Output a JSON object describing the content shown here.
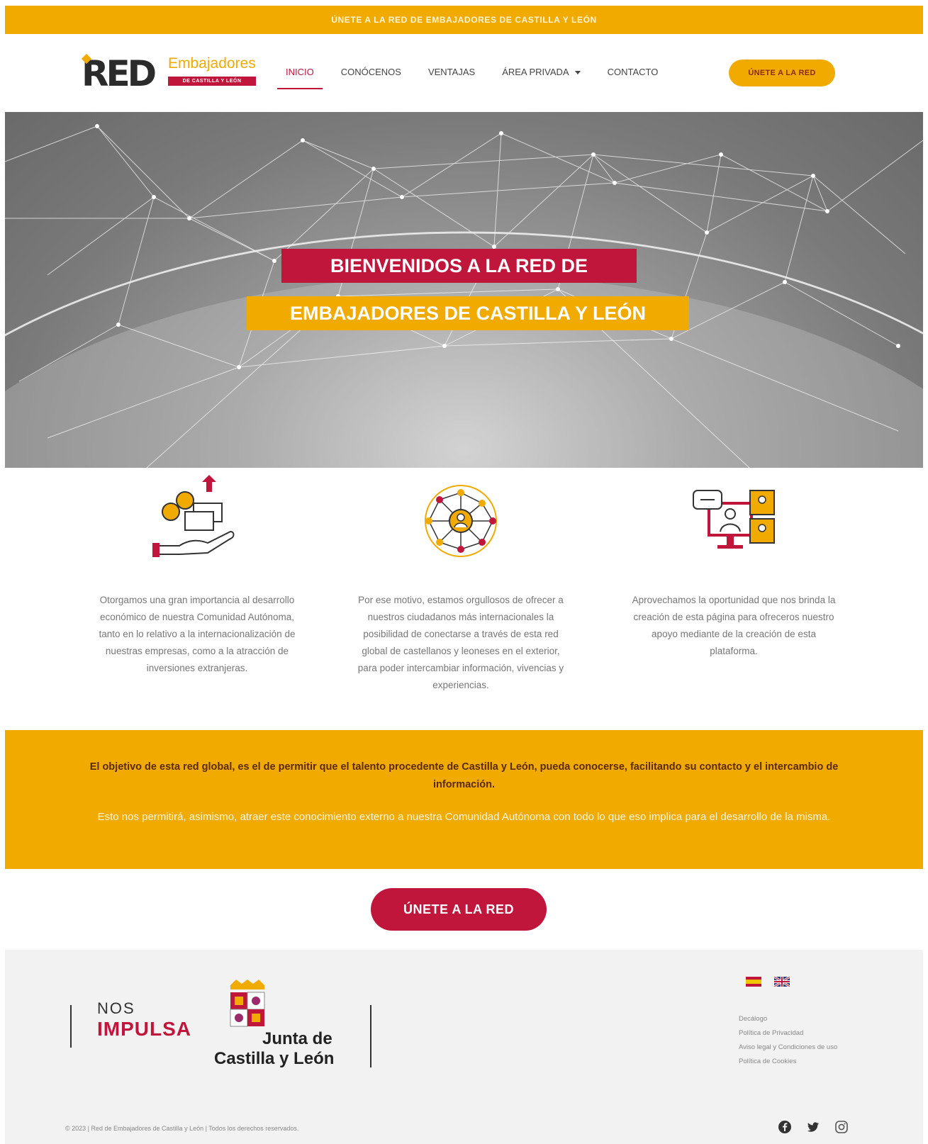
{
  "topbar": {
    "text": "ÚNETE A LA RED DE EMBAJADORES DE CASTILLA Y LEÓN"
  },
  "logo": {
    "main": "RED",
    "emb": "Embajadores",
    "sub": "DE CASTILLA Y LEÓN"
  },
  "nav": {
    "items": [
      {
        "label": "INICIO",
        "active": true
      },
      {
        "label": "CONÓCENOS"
      },
      {
        "label": "VENTAJAS"
      },
      {
        "label": "ÁREA PRIVADA",
        "dropdown": true
      },
      {
        "label": "CONTACTO"
      }
    ],
    "join_label": "ÚNETE A LA RED"
  },
  "hero": {
    "line1": "BIENVENIDOS A LA RED DE",
    "line2": "EMBAJADORES DE CASTILLA Y LEÓN"
  },
  "features": [
    {
      "icon": "money-hand-icon",
      "text": "Otorgamos una gran importancia al desarrollo económico de nuestra Comunidad Autónoma, tanto en lo relativo a la internacionalización de nuestras empresas, como a la atracción de inversiones extranjeras."
    },
    {
      "icon": "globe-network-icon",
      "text": "Por ese motivo, estamos orgullosos de ofrecer a nuestros ciudadanos más internacionales la posibilidad de conectarse a través de esta red global de castellanos y leoneses en el exterior, para poder intercambiar información, vivencias y experiencias."
    },
    {
      "icon": "video-conference-icon",
      "text": "Aprovechamos la oportunidad que nos brinda la creación de esta página para ofreceros nuestro apoyo mediante de la creación de esta plataforma."
    }
  ],
  "band": {
    "bold": "El objetivo de esta red global, es el de permitir que el talento procedente de Castilla y León, pueda conocerse, facilitando su contacto y el intercambio de información.",
    "normal": "Esto nos permitirá, asimismo, atraer este conocimiento externo a nuestra Comunidad Autónoma con todo lo que eso implica para el desarrollo de la misma."
  },
  "cta": {
    "label": "ÚNETE A LA RED"
  },
  "footer": {
    "nos": "NOS",
    "impulsa": "IMPULSA",
    "junta_line1": "Junta de",
    "junta_line2": "Castilla y León",
    "links": [
      "Decálogo",
      "Política de Privacidad",
      "Aviso legal y Condiciones de uso",
      "Política de Cookies"
    ],
    "copyright": "© 2023 | Red de Embajadores de Castilla y León | Todos los derechos reservados.",
    "social": [
      "facebook-icon",
      "twitter-icon",
      "instagram-icon"
    ]
  },
  "colors": {
    "accent": "#f1aa00",
    "brand": "#c1163c"
  }
}
